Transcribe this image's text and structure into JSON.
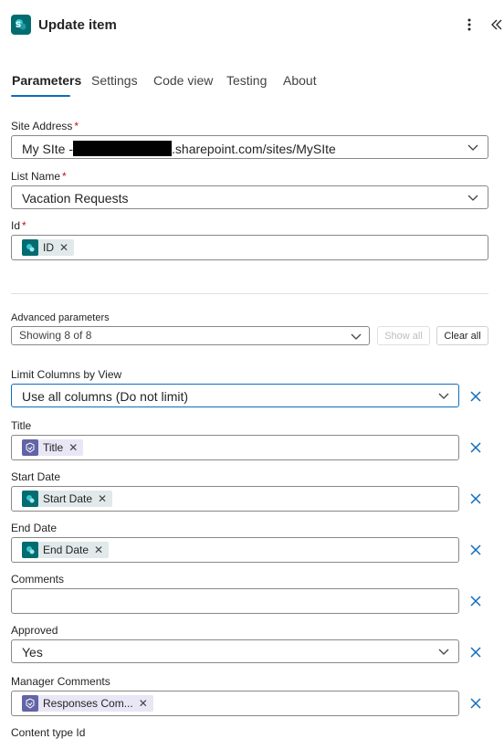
{
  "header": {
    "title": "Update item",
    "app_icon": "sharepoint-icon",
    "more_icon": "more-vertical-icon",
    "collapse_icon": "double-chevron-left-icon"
  },
  "tabs": [
    {
      "label": "Parameters",
      "active": true
    },
    {
      "label": "Settings"
    },
    {
      "label": "Code view"
    },
    {
      "label": "Testing"
    },
    {
      "label": "About"
    }
  ],
  "site_address": {
    "label": "Site Address",
    "required_mark": "*",
    "value_prefix": "My SIte -",
    "value_suffix": ".sharepoint.com/sites/MySIte"
  },
  "list_name": {
    "label": "List Name",
    "required_mark": "*",
    "value": "Vacation Requests"
  },
  "id_field": {
    "label": "Id",
    "required_mark": "*",
    "token": "ID"
  },
  "advanced": {
    "label": "Advanced parameters",
    "value": "Showing 8 of 8",
    "show_all": "Show all",
    "clear_all": "Clear all"
  },
  "limit_columns": {
    "label": "Limit Columns by View",
    "value": "Use all columns (Do not limit)"
  },
  "title_field": {
    "label": "Title",
    "token": "Title"
  },
  "start_date": {
    "label": "Start Date",
    "token": "Start Date"
  },
  "end_date": {
    "label": "End Date",
    "token": "End Date"
  },
  "comments": {
    "label": "Comments",
    "value": ""
  },
  "approved": {
    "label": "Approved",
    "value": "Yes"
  },
  "manager_comments": {
    "label": "Manager Comments",
    "token": "Responses Com..."
  },
  "content_type": {
    "label": "Content type Id"
  },
  "colors": {
    "accent": "#0f6cbd",
    "sharepoint": "#036c70",
    "forms": "#6264a7",
    "required": "#c50f1f"
  }
}
